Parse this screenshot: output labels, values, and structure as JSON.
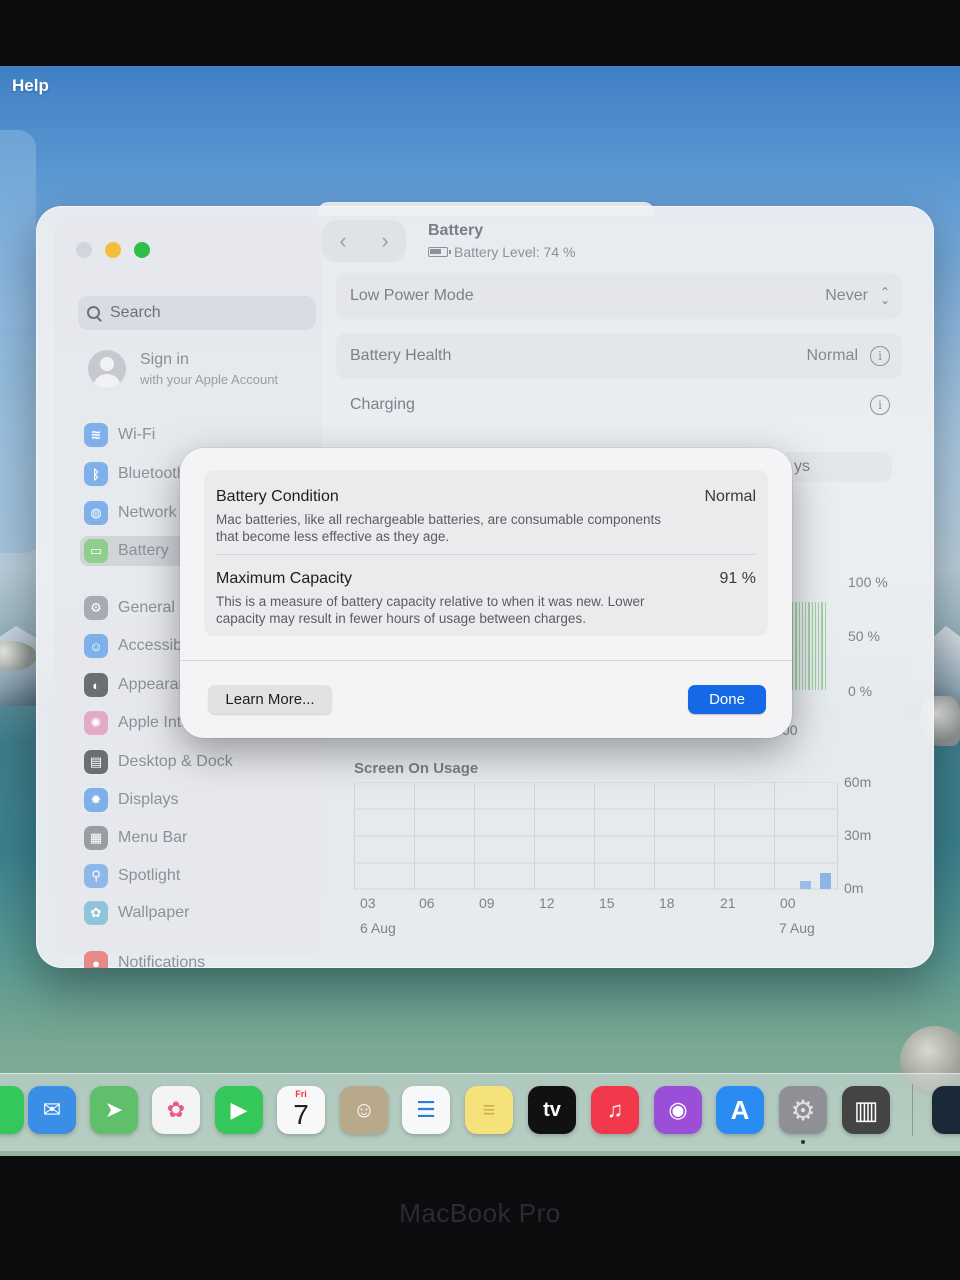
{
  "menubar": {
    "help": "Help"
  },
  "window": {
    "title": "Battery",
    "subtitle": "Battery Level: 74 %",
    "nav_back": "‹",
    "nav_forward": "›"
  },
  "sidebar": {
    "search_placeholder": "Search",
    "account_title": "Sign in",
    "account_sub": "with your Apple Account",
    "items": [
      {
        "label": "Wi-Fi",
        "glyph": "≋",
        "color": "#7fb0ea"
      },
      {
        "label": "Bluetooth",
        "glyph": "ᛒ",
        "color": "#7fb0ea"
      },
      {
        "label": "Network",
        "glyph": "◍",
        "color": "#7fb0ea"
      },
      {
        "label": "Battery",
        "glyph": "▭",
        "color": "#8fcf8e"
      },
      {
        "label": "General",
        "glyph": "⚙",
        "color": "#a8acb2"
      },
      {
        "label": "Accessibility",
        "glyph": "☺",
        "color": "#7fb0ea"
      },
      {
        "label": "Appearance",
        "glyph": "◐",
        "color": "#6b6e73"
      },
      {
        "label": "Apple Intelligence",
        "glyph": "✺",
        "color": "#e4a9c8"
      },
      {
        "label": "Desktop & Dock",
        "glyph": "▤",
        "color": "#6b6e73"
      },
      {
        "label": "Displays",
        "glyph": "✹",
        "color": "#7fb0ea"
      },
      {
        "label": "Menu Bar",
        "glyph": "▦",
        "color": "#9a9ea4"
      },
      {
        "label": "Spotlight",
        "glyph": "⚲",
        "color": "#8fb8ea"
      },
      {
        "label": "Wallpaper",
        "glyph": "✿",
        "color": "#8fc5d8"
      },
      {
        "label": "Notifications",
        "glyph": "●",
        "color": "#e58a8a"
      }
    ]
  },
  "settings": {
    "low_power_label": "Low Power Mode",
    "low_power_value": "Never",
    "health_label": "Battery Health",
    "health_value": "Normal",
    "charging_label": "Charging",
    "hidden_row_suffix": "ys"
  },
  "charts": {
    "level_labels": [
      "100 %",
      "50 %",
      "0 %"
    ],
    "level_hour_tail": "00",
    "usage_title": "Screen On Usage",
    "usage_y_labels": [
      "60m",
      "30m",
      "0m"
    ],
    "usage_x_labels": [
      "03",
      "06",
      "09",
      "12",
      "15",
      "18",
      "21",
      "00"
    ],
    "usage_dates": [
      "6 Aug",
      "7 Aug"
    ]
  },
  "modal": {
    "condition_title": "Battery Condition",
    "condition_value": "Normal",
    "condition_desc": "Mac batteries, like all rechargeable batteries, are consumable components that become less effective as they age.",
    "capacity_title": "Maximum Capacity",
    "capacity_value": "91 %",
    "capacity_desc": "This is a measure of battery capacity relative to when it was new. Lower capacity may result in fewer hours of usage between charges.",
    "learn_more": "Learn More...",
    "done": "Done"
  },
  "dock": {
    "apps": [
      {
        "name": "mail",
        "glyph": "✉",
        "color": "#3a8ee6"
      },
      {
        "name": "maps",
        "glyph": "➤",
        "color": "#5fbf6a"
      },
      {
        "name": "photos",
        "glyph": "✿",
        "color": "#f4f4f4"
      },
      {
        "name": "facetime",
        "glyph": "▶",
        "color": "#34c759"
      },
      {
        "name": "calendar",
        "glyph": "7",
        "color": "#f8f8f8"
      },
      {
        "name": "contacts",
        "glyph": "☺",
        "color": "#b8a98a"
      },
      {
        "name": "reminders",
        "glyph": "☰",
        "color": "#f8f8f8"
      },
      {
        "name": "notes",
        "glyph": "≡",
        "color": "#f6e27a"
      },
      {
        "name": "apple-tv",
        "glyph": "tv",
        "color": "#111111"
      },
      {
        "name": "music",
        "glyph": "♫",
        "color": "#f2384b"
      },
      {
        "name": "podcasts",
        "glyph": "◉",
        "color": "#9b4fd9"
      },
      {
        "name": "app-store",
        "glyph": "A",
        "color": "#2a8cf2"
      },
      {
        "name": "system-settings",
        "glyph": "⚙",
        "color": "#8e9096"
      },
      {
        "name": "piano",
        "glyph": "▥",
        "color": "#444444"
      }
    ],
    "calendar_month": "Fri"
  },
  "bezel": {
    "brand": "MacBook Pro"
  }
}
